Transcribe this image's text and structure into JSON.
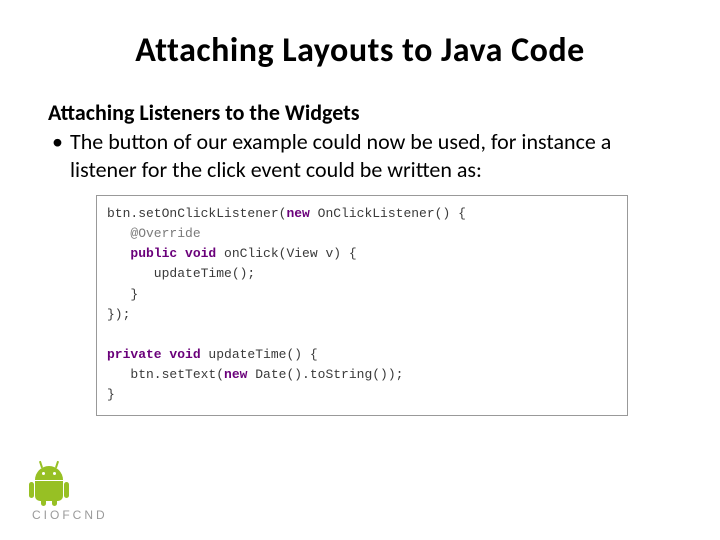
{
  "title": "Attaching Layouts to Java Code",
  "subtitle": "Attaching Listeners to the Widgets",
  "bullet": "The button of our example could now be used, for instance a listener for the click event could be written as:",
  "code": {
    "l1a": "btn.setOnClickListener(",
    "l1b": "new",
    "l1c": " OnClickListener() {",
    "l2": "   @Override",
    "l3a": "   ",
    "l3b": "public void",
    "l3c": " onClick(View v) {",
    "l4": "      updateTime();",
    "l5": "   }",
    "l6": "});",
    "l7": " ",
    "l8a": "private void",
    "l8b": " updateTime() {",
    "l9a": "   btn.setText(",
    "l9b": "new",
    "l9c": " Date().toString());",
    "l10": "}"
  },
  "footer": {
    "wordmark": "CIOFCND"
  }
}
